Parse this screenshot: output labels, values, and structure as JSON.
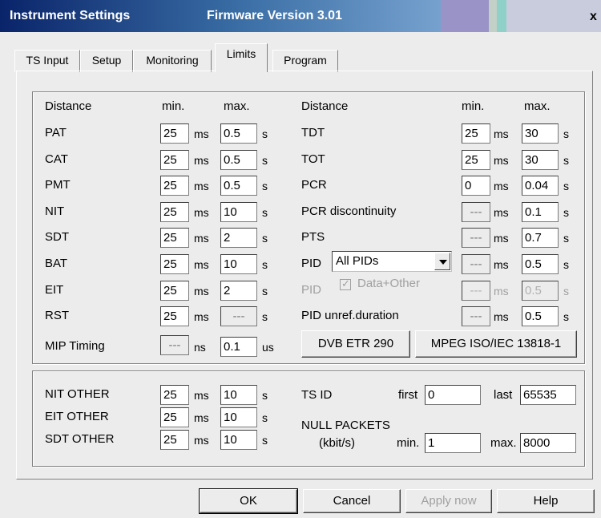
{
  "window": {
    "title": "Instrument Settings",
    "firmware": "Firmware Version 3.01",
    "close_glyph": "x"
  },
  "tabs": [
    "TS Input",
    "Setup",
    "Monitoring",
    "Limits",
    "Program"
  ],
  "active_tab": "Limits",
  "left": {
    "header": {
      "col": "Distance",
      "min": "min.",
      "max": "max."
    },
    "rows": [
      {
        "label": "PAT",
        "min": "25",
        "min_unit": "ms",
        "max": "0.5",
        "max_unit": "s"
      },
      {
        "label": "CAT",
        "min": "25",
        "min_unit": "ms",
        "max": "0.5",
        "max_unit": "s"
      },
      {
        "label": "PMT",
        "min": "25",
        "min_unit": "ms",
        "max": "0.5",
        "max_unit": "s"
      },
      {
        "label": "NIT",
        "min": "25",
        "min_unit": "ms",
        "max": "10",
        "max_unit": "s"
      },
      {
        "label": "SDT",
        "min": "25",
        "min_unit": "ms",
        "max": "2",
        "max_unit": "s"
      },
      {
        "label": "BAT",
        "min": "25",
        "min_unit": "ms",
        "max": "10",
        "max_unit": "s"
      },
      {
        "label": "EIT",
        "min": "25",
        "min_unit": "ms",
        "max": "2",
        "max_unit": "s"
      },
      {
        "label": "RST",
        "min": "25",
        "min_unit": "ms",
        "max": "---",
        "max_unit": "s"
      }
    ],
    "mip": {
      "label": "MIP Timing",
      "min": "---",
      "min_unit": "ns",
      "max": "0.1",
      "max_unit": "us"
    }
  },
  "right": {
    "header": {
      "col": "Distance",
      "min": "min.",
      "max": "max."
    },
    "rows": [
      {
        "label": "TDT",
        "min": "25",
        "min_unit": "ms",
        "max": "30",
        "max_unit": "s"
      },
      {
        "label": "TOT",
        "min": "25",
        "min_unit": "ms",
        "max": "30",
        "max_unit": "s"
      },
      {
        "label": "PCR",
        "min": "0",
        "min_unit": "ms",
        "max": "0.04",
        "max_unit": "s"
      },
      {
        "label": "PCR  discontinuity",
        "min": "---",
        "min_unit": "ms",
        "max": "0.1",
        "max_unit": "s"
      },
      {
        "label": "PTS",
        "min": "---",
        "min_unit": "ms",
        "max": "0.7",
        "max_unit": "s"
      },
      {
        "label": "PID",
        "min": "---",
        "min_unit": "ms",
        "max": "0.5",
        "max_unit": "s"
      },
      {
        "label": "PID",
        "min": "---",
        "min_unit": "ms",
        "max": "0.5",
        "max_unit": "s"
      },
      {
        "label": "PID  unref.duration",
        "min": "---",
        "min_unit": "ms",
        "max": "0.5",
        "max_unit": "s"
      }
    ],
    "pid_select": "All PIDs",
    "data_other": "Data+Other",
    "dvb_button": "DVB  ETR 290",
    "mpeg_button": "MPEG  ISO/IEC 13818-1"
  },
  "bottom": {
    "others": [
      {
        "label": "NIT OTHER",
        "min": "25",
        "min_unit": "ms",
        "max": "10",
        "max_unit": "s"
      },
      {
        "label": "EIT OTHER",
        "min": "25",
        "min_unit": "ms",
        "max": "10",
        "max_unit": "s"
      },
      {
        "label": "SDT OTHER",
        "min": "25",
        "min_unit": "ms",
        "max": "10",
        "max_unit": "s"
      }
    ],
    "tsid": {
      "label": "TS ID",
      "first_label": "first",
      "first": "0",
      "last_label": "last",
      "last": "65535"
    },
    "null_packets": {
      "label": "NULL PACKETS",
      "unit": "(kbit/s)",
      "min_label": "min.",
      "min": "1",
      "max_label": "max.",
      "max": "8000"
    }
  },
  "buttons": {
    "ok": "OK",
    "cancel": "Cancel",
    "apply": "Apply now",
    "help": "Help"
  }
}
